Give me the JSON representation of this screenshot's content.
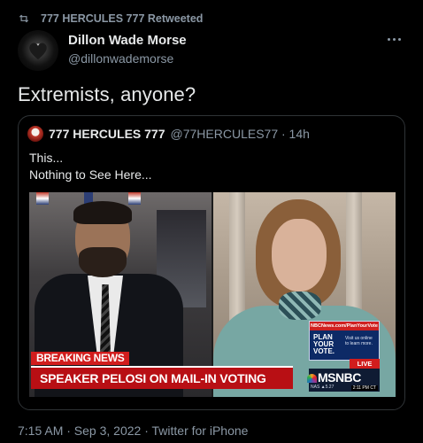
{
  "retweet": {
    "text": "777 HERCULES 777 Retweeted",
    "icon": "retweet-icon"
  },
  "tweet": {
    "display_name": "Dillon Wade Morse",
    "handle": "@dillonwademorse",
    "text": "Extremists, anyone?",
    "timestamp": "7:15 AM · Sep 3, 2022 · Twitter for iPhone"
  },
  "quote": {
    "display_name": "777 HERCULES 777",
    "handle": "@77HERCULES77 · 14h",
    "lines": [
      "This...",
      "Nothing to See Here..."
    ],
    "video": {
      "breaking": "BREAKING NEWS",
      "headline": "SPEAKER PELOSI ON MAIL-IN VOTING",
      "live": "LIVE",
      "network": "MSNBC",
      "ad_url": "NBCNews.com/PlanYourVote",
      "ad_title": "PLAN YOUR VOTE.",
      "ad_visit": "Visit us online to learn more.",
      "ticker": "NAS ▲5.27",
      "clock": "2:11 PM CT"
    }
  },
  "colors": {
    "background": "#000000",
    "text": "#e7e9ea",
    "secondary": "#8b98a5",
    "border": "#2f3336",
    "news_red": "#d11d1d"
  }
}
